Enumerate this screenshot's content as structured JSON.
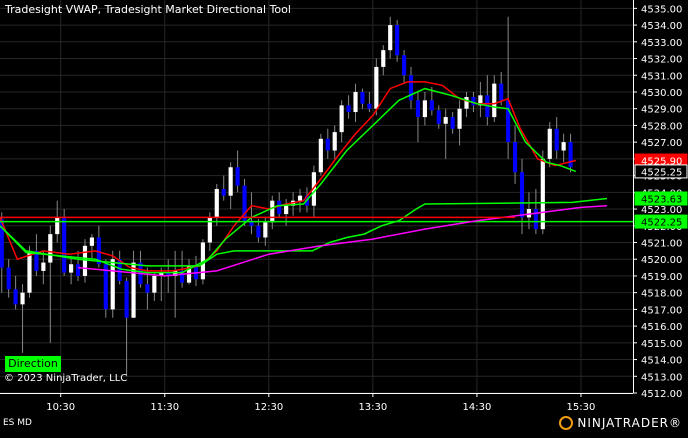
{
  "window": {
    "title": "Tradesight VWAP, Tradesight Market Directional Tool",
    "instrument": "ES MD",
    "copyright": "© 2023 NinjaTrader, LLC",
    "direction_label": "Direction",
    "logo_text": "NINJATRADER®"
  },
  "chart_data": {
    "type": "candlestick",
    "y_range": [
      4512,
      4535.5
    ],
    "y_ticks": [
      4512,
      4513,
      4514,
      4515,
      4516,
      4517,
      4518,
      4519,
      4520,
      4521,
      4522,
      4523,
      4524,
      4525,
      4526,
      4527,
      4528,
      4529,
      4530,
      4531,
      4532,
      4533,
      4534,
      4535
    ],
    "x_range": [
      "09:55",
      "16:00"
    ],
    "x_ticks": [
      "10:30",
      "11:30",
      "12:30",
      "13:30",
      "14:30",
      "15:30"
    ],
    "candles": [
      [
        "09:56",
        4522.4,
        4522.8,
        4518.0,
        4519.5,
        "down"
      ],
      [
        "10:00",
        4519.5,
        4520.0,
        4517.7,
        4518.2,
        "down"
      ],
      [
        "10:04",
        4518.2,
        4519.0,
        4517.0,
        4517.3,
        "down"
      ],
      [
        "10:08",
        4517.3,
        4518.5,
        4514.4,
        4518.0,
        "up"
      ],
      [
        "10:12",
        4518.0,
        4520.8,
        4517.7,
        4520.5,
        "up"
      ],
      [
        "10:16",
        4520.5,
        4521.5,
        4519.0,
        4519.3,
        "down"
      ],
      [
        "10:20",
        4519.3,
        4520.5,
        4518.5,
        4519.8,
        "up"
      ],
      [
        "10:24",
        4519.8,
        4522.0,
        4515.0,
        4521.5,
        "up"
      ],
      [
        "10:28",
        4521.5,
        4523.5,
        4521.0,
        4522.5,
        "up"
      ],
      [
        "10:32",
        4522.5,
        4523.0,
        4519.0,
        4519.2,
        "down"
      ],
      [
        "10:36",
        4519.2,
        4520.2,
        4518.5,
        4519.7,
        "up"
      ],
      [
        "10:40",
        4519.7,
        4520.5,
        4518.7,
        4519.0,
        "down"
      ],
      [
        "10:44",
        4519.0,
        4521.2,
        4518.6,
        4520.8,
        "up"
      ],
      [
        "10:48",
        4520.8,
        4521.5,
        4520.0,
        4521.3,
        "up"
      ],
      [
        "10:52",
        4521.3,
        4522.0,
        4519.5,
        4519.7,
        "down"
      ],
      [
        "10:56",
        4519.7,
        4520.0,
        4516.5,
        4517.0,
        "down"
      ],
      [
        "11:00",
        4517.0,
        4520.5,
        4516.5,
        4520.0,
        "up"
      ],
      [
        "11:04",
        4520.0,
        4520.5,
        4518.5,
        4518.7,
        "down"
      ],
      [
        "11:08",
        4518.7,
        4518.9,
        4513.0,
        4516.5,
        "down"
      ],
      [
        "11:12",
        4516.5,
        4520.5,
        4516.5,
        4519.8,
        "up"
      ],
      [
        "11:16",
        4519.8,
        4520.5,
        4518.3,
        4518.5,
        "down"
      ],
      [
        "11:20",
        4518.5,
        4519.5,
        4517.0,
        4518.0,
        "down"
      ],
      [
        "11:24",
        4518.0,
        4519.2,
        4517.5,
        4519.0,
        "up"
      ],
      [
        "11:28",
        4519.0,
        4519.5,
        4517.5,
        4519.2,
        "up"
      ],
      [
        "11:32",
        4519.2,
        4520.0,
        4518.0,
        4519.0,
        "down"
      ],
      [
        "11:36",
        4519.0,
        4520.5,
        4516.5,
        4519.3,
        "up"
      ],
      [
        "11:40",
        4519.3,
        4520.5,
        4518.3,
        4518.6,
        "down"
      ],
      [
        "11:44",
        4518.6,
        4520.0,
        4518.5,
        4519.6,
        "up"
      ],
      [
        "11:48",
        4519.6,
        4520.2,
        4518.4,
        4518.8,
        "down"
      ],
      [
        "11:52",
        4518.8,
        4521.2,
        4518.5,
        4521.0,
        "up"
      ],
      [
        "11:56",
        4521.0,
        4522.8,
        4520.5,
        4522.5,
        "up"
      ],
      [
        "12:00",
        4522.5,
        4524.5,
        4522.0,
        4524.2,
        "up"
      ],
      [
        "12:04",
        4524.2,
        4525.0,
        4523.5,
        4523.8,
        "down"
      ],
      [
        "12:08",
        4523.8,
        4525.8,
        4523.0,
        4525.5,
        "up"
      ],
      [
        "12:12",
        4525.5,
        4526.5,
        4524.0,
        4524.4,
        "down"
      ],
      [
        "12:16",
        4524.4,
        4524.8,
        4522.0,
        4522.3,
        "down"
      ],
      [
        "12:20",
        4522.3,
        4524.0,
        4521.5,
        4522.0,
        "down"
      ],
      [
        "12:24",
        4522.0,
        4522.4,
        4521.0,
        4521.3,
        "down"
      ],
      [
        "12:28",
        4521.3,
        4522.5,
        4520.8,
        4522.2,
        "up"
      ],
      [
        "12:32",
        4522.2,
        4523.8,
        4521.8,
        4523.5,
        "up"
      ],
      [
        "12:36",
        4523.5,
        4524.0,
        4522.5,
        4522.7,
        "down"
      ],
      [
        "12:40",
        4522.7,
        4523.6,
        4522.0,
        4523.2,
        "up"
      ],
      [
        "12:44",
        4523.2,
        4524.0,
        4522.6,
        4523.5,
        "up"
      ],
      [
        "12:48",
        4523.5,
        4524.2,
        4522.8,
        4523.8,
        "up"
      ],
      [
        "12:52",
        4523.8,
        4524.3,
        4522.8,
        4523.2,
        "down"
      ],
      [
        "12:56",
        4523.2,
        4525.6,
        4522.5,
        4525.2,
        "up"
      ],
      [
        "13:00",
        4525.2,
        4527.5,
        4525.0,
        4527.2,
        "up"
      ],
      [
        "13:04",
        4527.2,
        4527.8,
        4526.0,
        4526.5,
        "down"
      ],
      [
        "13:08",
        4526.5,
        4528.0,
        4526.0,
        4527.6,
        "up"
      ],
      [
        "13:12",
        4527.6,
        4529.5,
        4527.0,
        4529.2,
        "up"
      ],
      [
        "13:16",
        4529.2,
        4529.8,
        4528.4,
        4528.8,
        "down"
      ],
      [
        "13:20",
        4528.8,
        4530.5,
        4528.2,
        4530.0,
        "up"
      ],
      [
        "13:24",
        4530.0,
        4530.2,
        4529.0,
        4529.3,
        "down"
      ],
      [
        "13:28",
        4529.3,
        4530.0,
        4528.8,
        4529.0,
        "down"
      ],
      [
        "13:32",
        4529.0,
        4532.0,
        4528.6,
        4531.5,
        "up"
      ],
      [
        "13:36",
        4531.5,
        4532.8,
        4531.0,
        4532.5,
        "up"
      ],
      [
        "13:40",
        4532.5,
        4534.5,
        4532.0,
        4534.0,
        "up"
      ],
      [
        "13:44",
        4534.0,
        4534.3,
        4531.8,
        4532.2,
        "down"
      ],
      [
        "13:48",
        4532.2,
        4532.5,
        4530.5,
        4531.0,
        "down"
      ],
      [
        "13:52",
        4531.0,
        4531.5,
        4529.0,
        4529.5,
        "down"
      ],
      [
        "13:56",
        4529.5,
        4530.0,
        4527.0,
        4528.5,
        "down"
      ],
      [
        "14:00",
        4528.5,
        4530.0,
        4528.0,
        4529.5,
        "up"
      ],
      [
        "14:04",
        4529.5,
        4530.3,
        4528.6,
        4528.9,
        "down"
      ],
      [
        "14:08",
        4528.9,
        4529.2,
        4527.8,
        4528.1,
        "down"
      ],
      [
        "14:12",
        4528.1,
        4529.0,
        4526.0,
        4528.5,
        "up"
      ],
      [
        "14:16",
        4528.5,
        4528.8,
        4527.5,
        4527.8,
        "down"
      ],
      [
        "14:20",
        4527.8,
        4529.5,
        4526.8,
        4529.0,
        "up"
      ],
      [
        "14:24",
        4529.0,
        4530.0,
        4528.5,
        4529.7,
        "up"
      ],
      [
        "14:28",
        4529.7,
        4530.0,
        4528.8,
        4529.2,
        "down"
      ],
      [
        "14:32",
        4529.2,
        4530.6,
        4528.5,
        4529.8,
        "up"
      ],
      [
        "14:36",
        4529.8,
        4531.0,
        4528.0,
        4528.5,
        "down"
      ],
      [
        "14:40",
        4528.5,
        4531.0,
        4528.2,
        4530.5,
        "up"
      ],
      [
        "14:44",
        4530.5,
        4531.2,
        4529.2,
        4529.5,
        "down"
      ],
      [
        "14:48",
        4529.5,
        4534.5,
        4526.0,
        4527.0,
        "down"
      ],
      [
        "14:52",
        4527.0,
        4528.0,
        4524.5,
        4525.2,
        "down"
      ],
      [
        "14:56",
        4525.2,
        4526.0,
        4521.5,
        4522.5,
        "down"
      ],
      [
        "15:00",
        4522.5,
        4524.0,
        4521.8,
        4523.0,
        "up"
      ],
      [
        "15:04",
        4523.0,
        4524.2,
        4521.5,
        4521.8,
        "down"
      ],
      [
        "15:08",
        4521.8,
        4526.5,
        4521.5,
        4526.0,
        "up"
      ],
      [
        "15:12",
        4526.0,
        4528.2,
        4525.5,
        4527.8,
        "up"
      ],
      [
        "15:16",
        4527.8,
        4528.5,
        4526.0,
        4526.5,
        "down"
      ],
      [
        "15:20",
        4526.5,
        4527.5,
        4525.8,
        4527.0,
        "up"
      ],
      [
        "15:24",
        4527.0,
        4527.5,
        4525.2,
        4525.5,
        "down"
      ]
    ],
    "series": [
      {
        "name": "",
        "color": "#ff0000",
        "points": [
          [
            "09:55",
            4522.5
          ],
          [
            "10:05",
            4520.0
          ],
          [
            "10:20",
            4520.5
          ],
          [
            "10:35",
            4520.3
          ],
          [
            "10:50",
            4520.5
          ],
          [
            "11:00",
            4520.2
          ],
          [
            "11:10",
            4519.5
          ],
          [
            "11:20",
            4519.3
          ],
          [
            "11:35",
            4519.3
          ],
          [
            "11:50",
            4519.6
          ],
          [
            "12:00",
            4520.5
          ],
          [
            "12:10",
            4522.0
          ],
          [
            "12:20",
            4523.2
          ],
          [
            "12:30",
            4523.0
          ],
          [
            "12:40",
            4523.3
          ],
          [
            "12:50",
            4523.5
          ],
          [
            "13:00",
            4524.8
          ],
          [
            "13:10",
            4526.2
          ],
          [
            "13:20",
            4527.5
          ],
          [
            "13:30",
            4528.6
          ],
          [
            "13:40",
            4530.2
          ],
          [
            "13:50",
            4530.6
          ],
          [
            "14:00",
            4530.6
          ],
          [
            "14:10",
            4530.4
          ],
          [
            "14:20",
            4529.6
          ],
          [
            "14:30",
            4529.3
          ],
          [
            "14:40",
            4529.3
          ],
          [
            "14:48",
            4529.6
          ],
          [
            "14:55",
            4527.8
          ],
          [
            "15:05",
            4526.0
          ],
          [
            "15:15",
            4525.6
          ],
          [
            "15:27",
            4525.9
          ]
        ]
      },
      {
        "name": "",
        "color": "#00ff00",
        "points": [
          [
            "09:55",
            4522.0
          ],
          [
            "10:10",
            4520.4
          ],
          [
            "10:30",
            4520.2
          ],
          [
            "10:50",
            4520.0
          ],
          [
            "11:05",
            4519.4
          ],
          [
            "11:20",
            4519.2
          ],
          [
            "11:40",
            4519.2
          ],
          [
            "11:55",
            4520.0
          ],
          [
            "12:05",
            4521.2
          ],
          [
            "12:20",
            4522.5
          ],
          [
            "12:35",
            4523.2
          ],
          [
            "12:50",
            4523.3
          ],
          [
            "13:00",
            4524.5
          ],
          [
            "13:15",
            4526.5
          ],
          [
            "13:30",
            4528.0
          ],
          [
            "13:45",
            4529.5
          ],
          [
            "14:00",
            4530.2
          ],
          [
            "14:15",
            4529.8
          ],
          [
            "14:30",
            4529.3
          ],
          [
            "14:40",
            4529.1
          ],
          [
            "14:48",
            4529.0
          ],
          [
            "14:58",
            4527.0
          ],
          [
            "15:10",
            4525.8
          ],
          [
            "15:18",
            4525.6
          ],
          [
            "15:27",
            4525.25
          ]
        ]
      },
      {
        "name": "",
        "color": "#00ff00",
        "points": [
          [
            "09:55",
            4522.25
          ],
          [
            "16:00",
            4522.25
          ]
        ]
      },
      {
        "name": "",
        "color": "#00ff00",
        "points": [
          [
            "09:55",
            4522.0
          ],
          [
            "10:10",
            4520.5
          ],
          [
            "10:40",
            4520.0
          ],
          [
            "11:20",
            4519.6
          ],
          [
            "11:50",
            4519.6
          ],
          [
            "12:00",
            4520.3
          ],
          [
            "12:10",
            4520.5
          ],
          [
            "12:55",
            4520.5
          ],
          [
            "13:05",
            4521.0
          ],
          [
            "13:15",
            4521.3
          ],
          [
            "13:25",
            4521.5
          ],
          [
            "13:35",
            4522.0
          ],
          [
            "13:45",
            4522.3
          ],
          [
            "13:55",
            4523.0
          ],
          [
            "14:00",
            4523.3
          ],
          [
            "15:25",
            4523.4
          ],
          [
            "15:45",
            4523.63
          ]
        ]
      },
      {
        "name": "",
        "color": "#ff00ff",
        "points": [
          [
            "10:40",
            4519.5
          ],
          [
            "11:00",
            4519.3
          ],
          [
            "11:30",
            4519.0
          ],
          [
            "12:00",
            4519.3
          ],
          [
            "12:30",
            4520.3
          ],
          [
            "13:00",
            4520.8
          ],
          [
            "13:30",
            4521.2
          ],
          [
            "14:00",
            4521.8
          ],
          [
            "14:30",
            4522.3
          ],
          [
            "15:00",
            4522.7
          ],
          [
            "15:30",
            4523.1
          ],
          [
            "15:45",
            4523.2
          ]
        ]
      },
      {
        "name": "",
        "color": "#ff0000",
        "points": [
          [
            "09:55",
            4522.5
          ],
          [
            "14:52",
            4522.5
          ]
        ]
      }
    ],
    "price_labels": [
      {
        "value": 4525.9,
        "text": "4525.90",
        "bg": "#ff0000",
        "fg": "#ffffff"
      },
      {
        "value": 4525.25,
        "text": "4525.25",
        "bg": "#000000",
        "fg": "#ffffff"
      },
      {
        "value": 4523.63,
        "text": "4523.63",
        "bg": "#00ff00",
        "fg": "#000000"
      },
      {
        "value": 4522.25,
        "text": "4522.25",
        "bg": "#00ff00",
        "fg": "#000000"
      }
    ],
    "colors": {
      "up": "#ffffff",
      "down": "#0000ff",
      "wick": "#888888",
      "grid": "#262626"
    },
    "grid": true,
    "legend": "none"
  }
}
